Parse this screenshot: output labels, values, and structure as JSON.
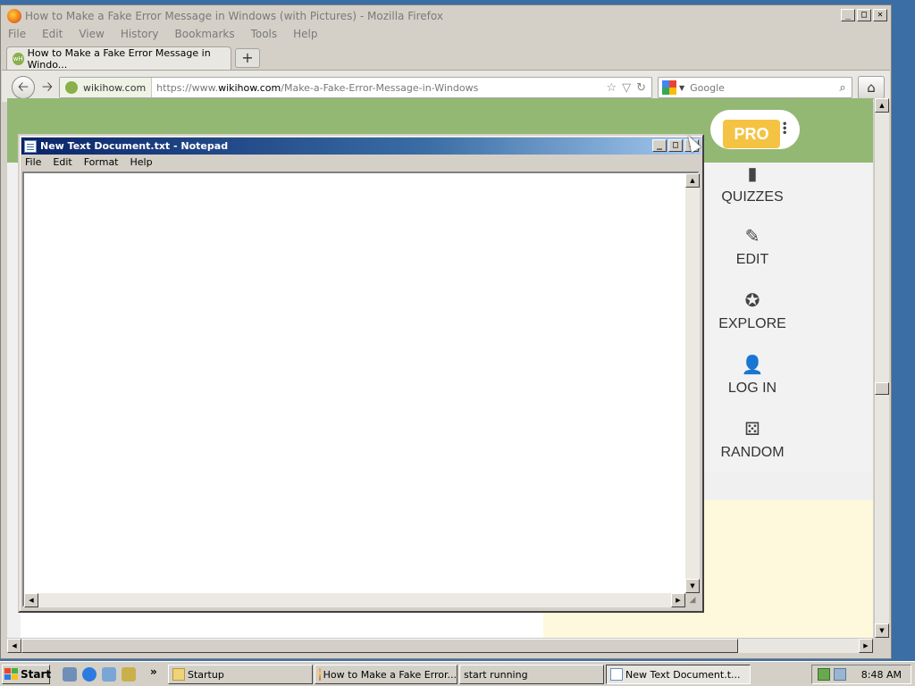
{
  "firefox": {
    "title": "How to Make a Fake Error Message in Windows (with Pictures) - Mozilla Firefox",
    "menu": [
      "File",
      "Edit",
      "View",
      "History",
      "Bookmarks",
      "Tools",
      "Help"
    ],
    "tab_label": "How to Make a Fake Error Message in Windo...",
    "new_tab": "+",
    "site_identity": "wikihow.com",
    "url_prefix": "https://www.",
    "url_domain": "wikihow.com",
    "url_path": "/Make-a-Fake-Error-Message-in-Windows",
    "search_placeholder": "Google"
  },
  "page": {
    "pro_label": "PRO",
    "nav": [
      {
        "label": "QUIZZES",
        "icon": "quiz-icon"
      },
      {
        "label": "EDIT",
        "icon": "pencil-icon"
      },
      {
        "label": "EXPLORE",
        "icon": "compass-icon"
      },
      {
        "label": "LOG IN",
        "icon": "user-icon"
      },
      {
        "label": "RANDOM",
        "icon": "dice-icon"
      }
    ],
    "colors": {
      "header_green": "#93b874",
      "pro_yellow": "#f5c343",
      "yellow_panel": "#fef9dc"
    }
  },
  "notepad": {
    "title": "New Text Document.txt - Notepad",
    "menu": [
      "File",
      "Edit",
      "Format",
      "Help"
    ],
    "content": ""
  },
  "taskbar": {
    "start_label": "Start",
    "more": "»",
    "tasks": [
      {
        "label": "Startup",
        "icon": "folder-icon"
      },
      {
        "label": "How to Make a Fake Error...",
        "icon": "firefox-icon"
      },
      {
        "label": "start running",
        "icon": ""
      },
      {
        "label": "New Text Document.t...",
        "icon": "notepad-icon"
      }
    ],
    "clock": "8:48 AM"
  }
}
